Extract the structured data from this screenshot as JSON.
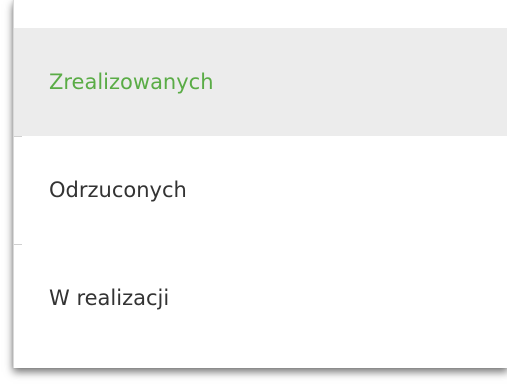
{
  "menu": {
    "items": [
      {
        "label": "Zrealizowanych",
        "active": true
      },
      {
        "label": "Odrzuconych",
        "active": false
      },
      {
        "label": "W realizacji",
        "active": false
      }
    ]
  },
  "colors": {
    "active_text": "#5aac46",
    "active_background": "#ececec",
    "text": "#333333"
  }
}
